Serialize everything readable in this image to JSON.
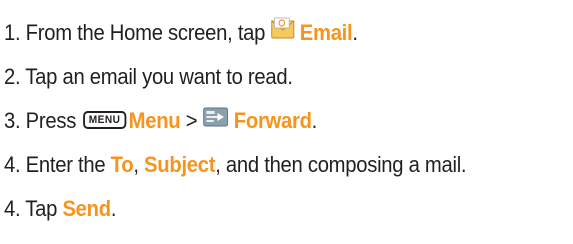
{
  "steps": [
    {
      "prefix": "1. From the Home screen, tap ",
      "target": "Email",
      "suffix": ".",
      "icon": "email-icon"
    },
    {
      "text": "2. Tap an email you want to read."
    },
    {
      "prefix": "3. Press ",
      "key_label": "MENU",
      "menu_label": "Menu",
      "sep": " > ",
      "icon": "forward-icon",
      "target": "Forward",
      "suffix": "."
    },
    {
      "prefix": "4. Enter the ",
      "to": "To",
      "comma1": ", ",
      "subject": "Subject",
      "suffix": ", and then composing a mail."
    },
    {
      "prefix": "4. Tap ",
      "target": "Send",
      "suffix": "."
    }
  ],
  "colors": {
    "accent": "#f7941d",
    "text": "#231f20"
  }
}
